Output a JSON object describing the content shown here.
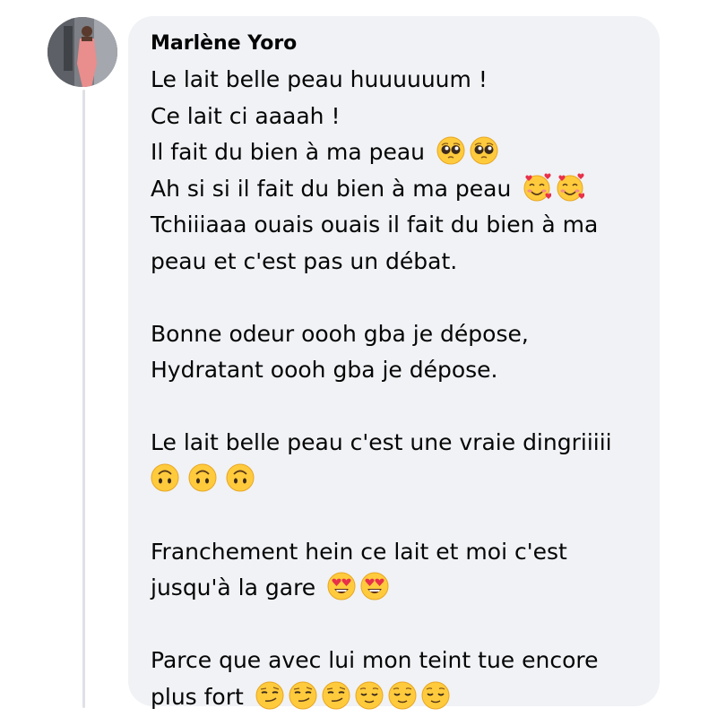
{
  "comment": {
    "author": "Marlène Yoro",
    "lines": [
      "Le lait belle peau huuuuuum !",
      "Ce lait ci aaaah !",
      "Il fait du bien à ma peau",
      "Ah si si il fait du bien à ma peau",
      "Tchiiiaaa ouais ouais il fait du bien à ma",
      "peau et c'est pas un débat.",
      "",
      "Bonne odeur oooh gba je dépose,",
      "Hydratant oooh gba je dépose.",
      "",
      "Le lait belle peau c'est une vraie dingriiiii",
      "",
      "",
      "Franchement hein ce lait et moi c'est",
      "jusqu'à la gare",
      "",
      "Parce que avec lui mon teint tue encore",
      "plus fort"
    ],
    "emoji": {
      "line3": [
        "pleading-face",
        "pleading-face"
      ],
      "line4": [
        "smiling-face-with-hearts",
        "smiling-face-with-hearts"
      ],
      "line12": [
        "upside-down-face",
        "upside-down-face",
        "upside-down-face"
      ],
      "line15": [
        "heart-eyes-face",
        "heart-eyes-face"
      ],
      "line18": [
        "smirking-face",
        "smirking-face",
        "smirking-face",
        "relieved-face",
        "relieved-face",
        "relieved-face"
      ]
    }
  },
  "colors": {
    "bubble": "#f0f2f5",
    "text": "#050505",
    "thread_line": "#dfe1e5",
    "emoji_yellow": "#ffcb3d"
  }
}
